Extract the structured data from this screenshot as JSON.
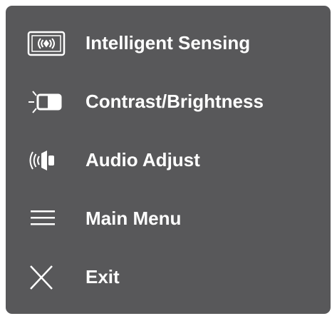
{
  "menu": {
    "items": [
      {
        "label": "Intelligent Sensing",
        "icon": "intelligent-sensing-icon"
      },
      {
        "label": "Contrast/Brightness",
        "icon": "contrast-brightness-icon"
      },
      {
        "label": "Audio Adjust",
        "icon": "speaker-icon"
      },
      {
        "label": "Main Menu",
        "icon": "hamburger-menu-icon"
      },
      {
        "label": "Exit",
        "icon": "close-icon"
      }
    ]
  },
  "colors": {
    "panel_background": "#58585a",
    "text": "#ffffff"
  }
}
